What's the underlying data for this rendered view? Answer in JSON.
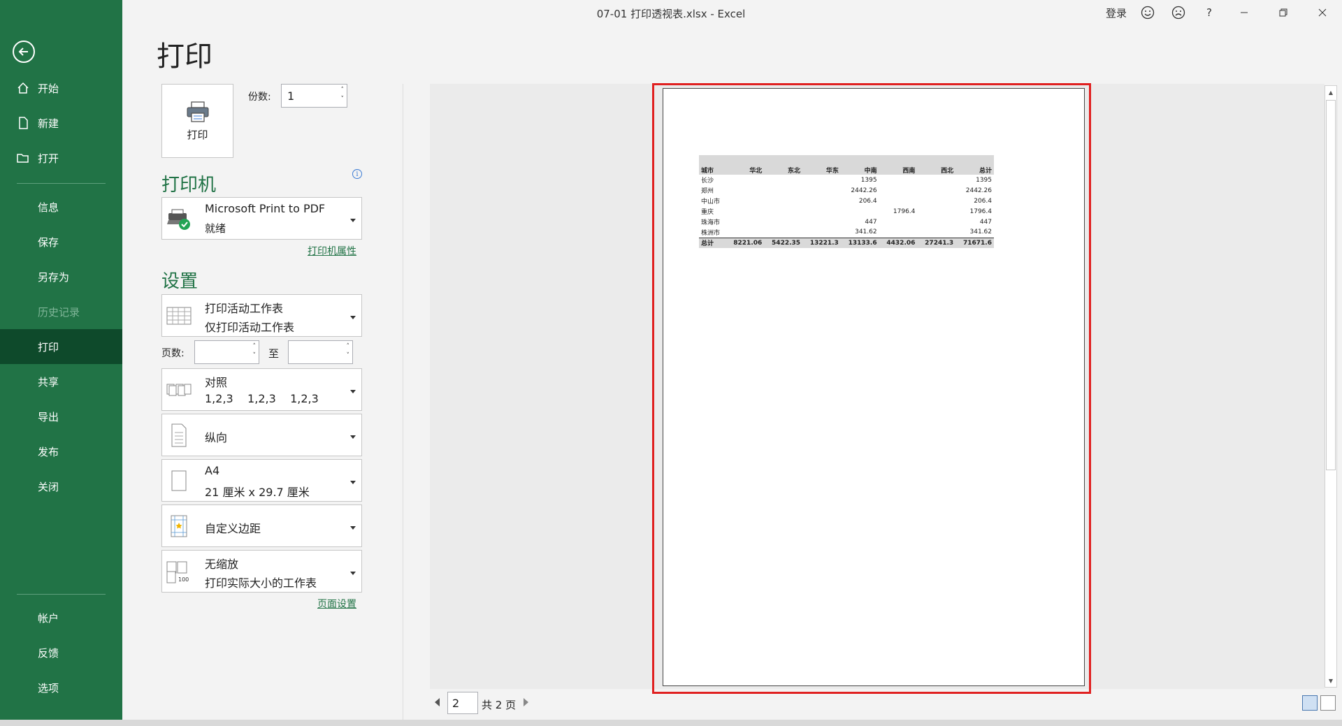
{
  "window": {
    "title": "07-01 打印透视表.xlsx  -  Excel",
    "login": "登录",
    "help": "?"
  },
  "sidebar": {
    "items": [
      {
        "label": "开始"
      },
      {
        "label": "新建"
      },
      {
        "label": "打开"
      },
      {
        "label": "信息"
      },
      {
        "label": "保存"
      },
      {
        "label": "另存为"
      },
      {
        "label": "历史记录"
      },
      {
        "label": "打印"
      },
      {
        "label": "共享"
      },
      {
        "label": "导出"
      },
      {
        "label": "发布"
      },
      {
        "label": "关闭"
      },
      {
        "label": "帐户"
      },
      {
        "label": "反馈"
      },
      {
        "label": "选项"
      }
    ]
  },
  "print": {
    "title": "打印",
    "button_label": "打印",
    "copies_label": "份数:",
    "copies_value": "1",
    "printer_section": "打印机",
    "printer_name": "Microsoft Print to PDF",
    "printer_status": "就绪",
    "printer_props_link": "打印机属性",
    "settings_section": "设置",
    "what_to_print": {
      "main": "打印活动工作表",
      "sub": "仅打印活动工作表"
    },
    "pages_label": "页数:",
    "pages_to": "至",
    "collate": {
      "main": "对照",
      "sub": "1,2,3    1,2,3    1,2,3"
    },
    "orientation": {
      "main": "纵向"
    },
    "paper": {
      "main": "A4",
      "sub": "21 厘米 x 29.7 厘米"
    },
    "margins": {
      "main": "自定义边距"
    },
    "scaling": {
      "main": "无缩放",
      "sub": "打印实际大小的工作表"
    },
    "page_setup_link": "页面设置"
  },
  "preview": {
    "current_page": "2",
    "total_pages": "共 2 页",
    "table": {
      "headers": [
        "城市",
        "华北",
        "东北",
        "华东",
        "中南",
        "西南",
        "西北",
        "总计"
      ],
      "rows": [
        [
          "长沙",
          "",
          "",
          "",
          "1395",
          "",
          "",
          "1395"
        ],
        [
          "郑州",
          "",
          "",
          "",
          "2442.26",
          "",
          "",
          "2442.26"
        ],
        [
          "中山市",
          "",
          "",
          "",
          "206.4",
          "",
          "",
          "206.4"
        ],
        [
          "重庆",
          "",
          "",
          "",
          "",
          "1796.4",
          "",
          "1796.4"
        ],
        [
          "珠海市",
          "",
          "",
          "",
          "447",
          "",
          "",
          "447"
        ],
        [
          "株洲市",
          "",
          "",
          "",
          "341.62",
          "",
          "",
          "341.62"
        ]
      ],
      "total": [
        "总计",
        "8221.06",
        "5422.35",
        "13221.3",
        "13133.6",
        "4432.06",
        "27241.3",
        "71671.6"
      ]
    }
  }
}
